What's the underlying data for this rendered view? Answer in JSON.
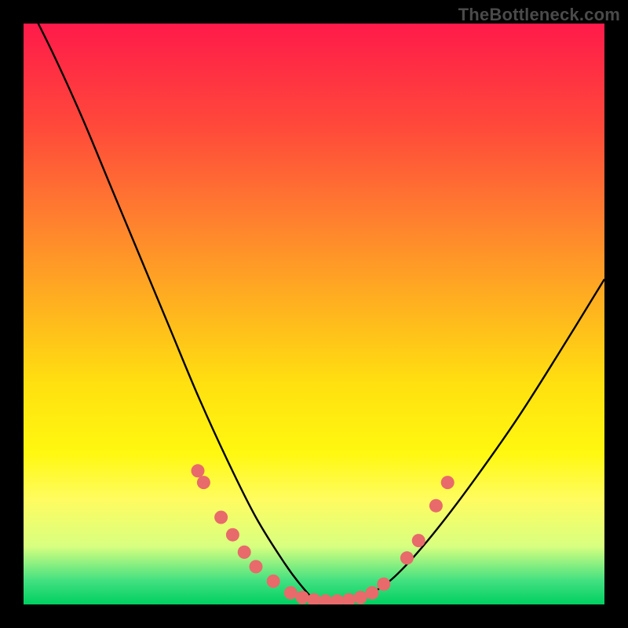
{
  "watermark": "TheBottleneck.com",
  "chart_data": {
    "type": "line",
    "title": "",
    "xlabel": "",
    "ylabel": "",
    "xlim": [
      0,
      100
    ],
    "ylim": [
      0,
      100
    ],
    "series": [
      {
        "name": "bottleneck-curve",
        "x": [
          0,
          5,
          10,
          15,
          20,
          25,
          30,
          35,
          40,
          45,
          48,
          50,
          52,
          55,
          58,
          60,
          63,
          67,
          72,
          78,
          85,
          92,
          100
        ],
        "y": [
          105,
          95,
          84,
          72,
          60,
          48,
          36,
          25,
          15,
          7,
          3,
          1,
          0.5,
          0.5,
          1,
          2,
          4,
          8,
          14,
          22,
          32,
          43,
          56
        ]
      }
    ],
    "highlight_dots": {
      "name": "marked-points",
      "color": "#e86a6a",
      "points": [
        {
          "x": 30,
          "y": 23
        },
        {
          "x": 31,
          "y": 21
        },
        {
          "x": 34,
          "y": 15
        },
        {
          "x": 36,
          "y": 12
        },
        {
          "x": 38,
          "y": 9
        },
        {
          "x": 40,
          "y": 6.5
        },
        {
          "x": 43,
          "y": 4
        },
        {
          "x": 46,
          "y": 2
        },
        {
          "x": 48,
          "y": 1.2
        },
        {
          "x": 50,
          "y": 0.8
        },
        {
          "x": 52,
          "y": 0.6
        },
        {
          "x": 54,
          "y": 0.6
        },
        {
          "x": 56,
          "y": 0.8
        },
        {
          "x": 58,
          "y": 1.2
        },
        {
          "x": 60,
          "y": 2
        },
        {
          "x": 62,
          "y": 3.5
        },
        {
          "x": 66,
          "y": 8
        },
        {
          "x": 68,
          "y": 11
        },
        {
          "x": 71,
          "y": 17
        },
        {
          "x": 73,
          "y": 21
        }
      ]
    },
    "colors": {
      "curve": "#000000",
      "dots": "#e86a6a",
      "gradient_top": "#ff1a4a",
      "gradient_bottom": "#00d060"
    }
  }
}
